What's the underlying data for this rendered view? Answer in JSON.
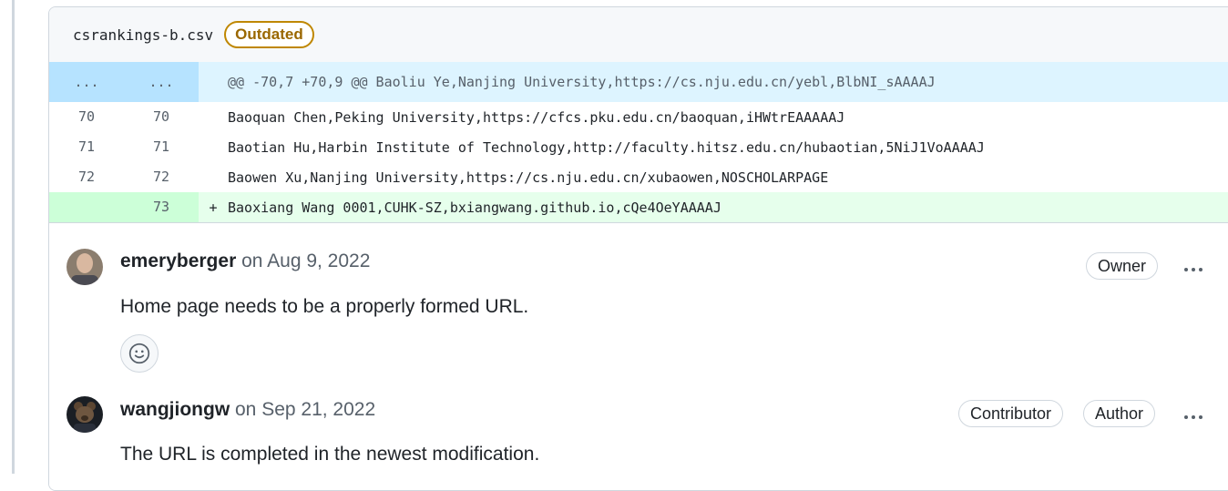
{
  "file": {
    "name": "csrankings-b.csv",
    "badge": "Outdated"
  },
  "diff": {
    "hunk": {
      "old_num": "...",
      "new_num": "...",
      "text": "@@ -70,7 +70,9 @@ Baoliu Ye,Nanjing University,https://cs.nju.edu.cn/yebl,BlbNI_sAAAAJ"
    },
    "lines": [
      {
        "old": "70",
        "new": "70",
        "marker": "",
        "text": "Baoquan Chen,Peking University,https://cfcs.pku.edu.cn/baoquan,iHWtrEAAAAAJ"
      },
      {
        "old": "71",
        "new": "71",
        "marker": "",
        "text": "Baotian Hu,Harbin Institute of Technology,http://faculty.hitsz.edu.cn/hubaotian,5NiJ1VoAAAAJ"
      },
      {
        "old": "72",
        "new": "72",
        "marker": "",
        "text": "Baowen Xu,Nanjing University,https://cs.nju.edu.cn/xubaowen,NOSCHOLARPAGE"
      },
      {
        "old": "",
        "new": "73",
        "marker": "+",
        "text": "Baoxiang Wang 0001,CUHK-SZ,bxiangwang.github.io,cQe4OeYAAAAJ"
      }
    ]
  },
  "comments": [
    {
      "author": "emeryberger",
      "date": "on Aug 9, 2022",
      "badges": [
        "Owner"
      ],
      "body": "Home page needs to be a properly formed URL."
    },
    {
      "author": "wangjiongw",
      "date": "on Sep 21, 2022",
      "badges": [
        "Contributor",
        "Author"
      ],
      "body": "The URL is completed in the newest modification."
    }
  ],
  "icons": {
    "reaction": "smiley-icon",
    "more": "kebab-horizontal-icon"
  },
  "colors": {
    "hunk_bg": "#ddf4ff",
    "added_bg": "#e6ffec",
    "outdated": "#9a6700"
  }
}
